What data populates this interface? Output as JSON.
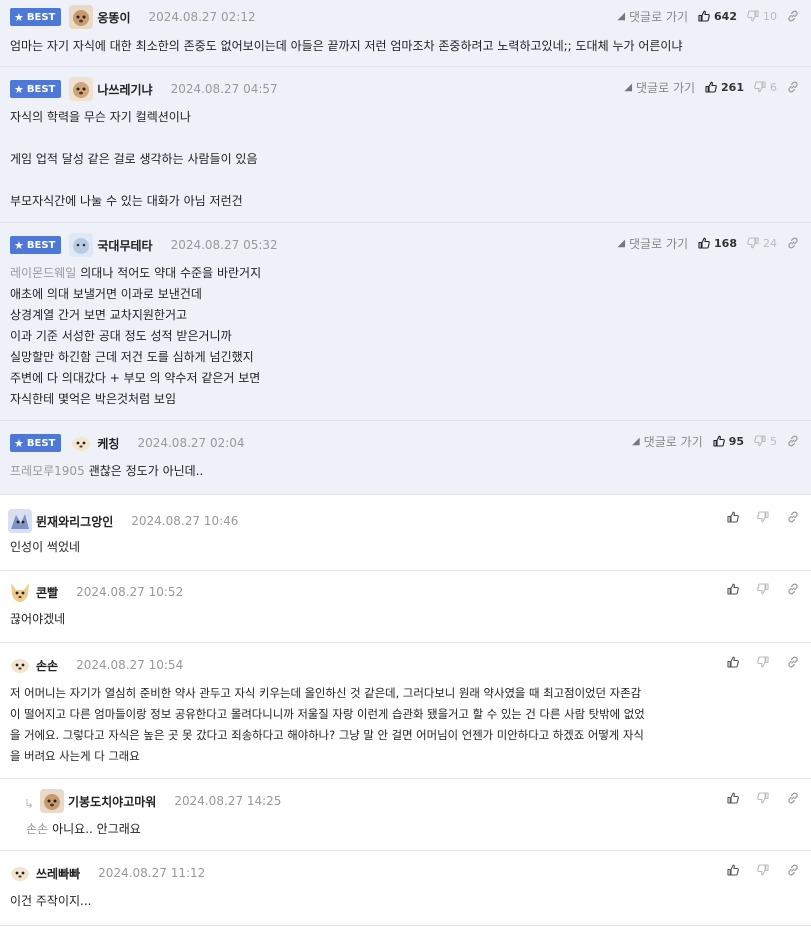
{
  "ui": {
    "best_label": "BEST",
    "reply_label": "댓글로 가기"
  },
  "comments": [
    {
      "nick": "옹똥이",
      "date": "2024.08.27 02:12",
      "up": "642",
      "down": "10",
      "lines": [
        "엄마는 자기 자식에 대한 최소한의 존중도 없어보이는데 아들은 끝까지 저런 엄마조차 존중하려고 노력하고있네;; 도대체 누가 어른이냐"
      ]
    },
    {
      "nick": "나쓰레기냐",
      "date": "2024.08.27 04:57",
      "up": "261",
      "down": "6",
      "lines": [
        "자식의 학력을 무슨 자기 컬렉션이나",
        "",
        "게임 업적 달성 같은 걸로 생각하는 사람들이 있음",
        "",
        "부모자식간에 나눌 수 있는 대화가 아님 저런건"
      ]
    },
    {
      "nick": "국대무테타",
      "date": "2024.08.27 05:32",
      "up": "168",
      "down": "24",
      "ref": "레이몬드웨일",
      "lines": [
        "의대나 적어도 약대 수준을 바란거지",
        "애초에 의대 보낼거면 이과로 보낸건데",
        "상경계열 간거 보면 교차지원한거고",
        "이과 기준 서성한 공대 정도 성적 받은거니까",
        "실망할만 하긴함 근데 저건 도를 심하게 넘긴했지",
        "주변에 다 의대갔다 + 부모 의 약수저 같은거 보면",
        "자식한테 몇억은 박은것처럼 보임"
      ]
    },
    {
      "nick": "케칭",
      "date": "2024.08.27 02:04",
      "up": "95",
      "down": "5",
      "ref": "프레모루1905",
      "lines": [
        "괜찮은 정도가 아닌데.."
      ]
    },
    {
      "nick": "뮌재와리그앙인",
      "date": "2024.08.27 10:46",
      "lines": [
        "인성이 썩었네"
      ]
    },
    {
      "nick": "콘빨",
      "date": "2024.08.27 10:52",
      "lines": [
        "끊어야겠네"
      ]
    },
    {
      "nick": "손손",
      "date": "2024.08.27 10:54",
      "lines": [
        "저 어머니는 자기가 열심히 준비한 약사 관두고 자식 키우는데 올인하신 것 같은데, 그러다보니 원래 약사였을 때 최고점이었던 자존감",
        "이 떨어지고 다른 엄마들이랑 정보 공유한다고 몰려다니니까 저울질 자랑 이런게 습관화 됐을거고 할 수 있는 건 다른 사람 탓밖에 없었",
        "을 거에요. 그렇다고 자식은 높은 곳 못 갔다고 죄송하다고 해야하나? 그냥 말 안 걸면 어머님이 언젠가 미안하다고 하겠죠 어떻게 자식",
        "을 버려요 사는게 다 그래요"
      ]
    },
    {
      "nick": "기봉도치야고마워",
      "date": "2024.08.27 14:25",
      "ref": "손손",
      "lines": [
        "아니요.. 안그래요"
      ]
    },
    {
      "nick": "쓰레빠빠",
      "date": "2024.08.27 11:12",
      "lines": [
        "이건 주작이지..."
      ]
    }
  ]
}
